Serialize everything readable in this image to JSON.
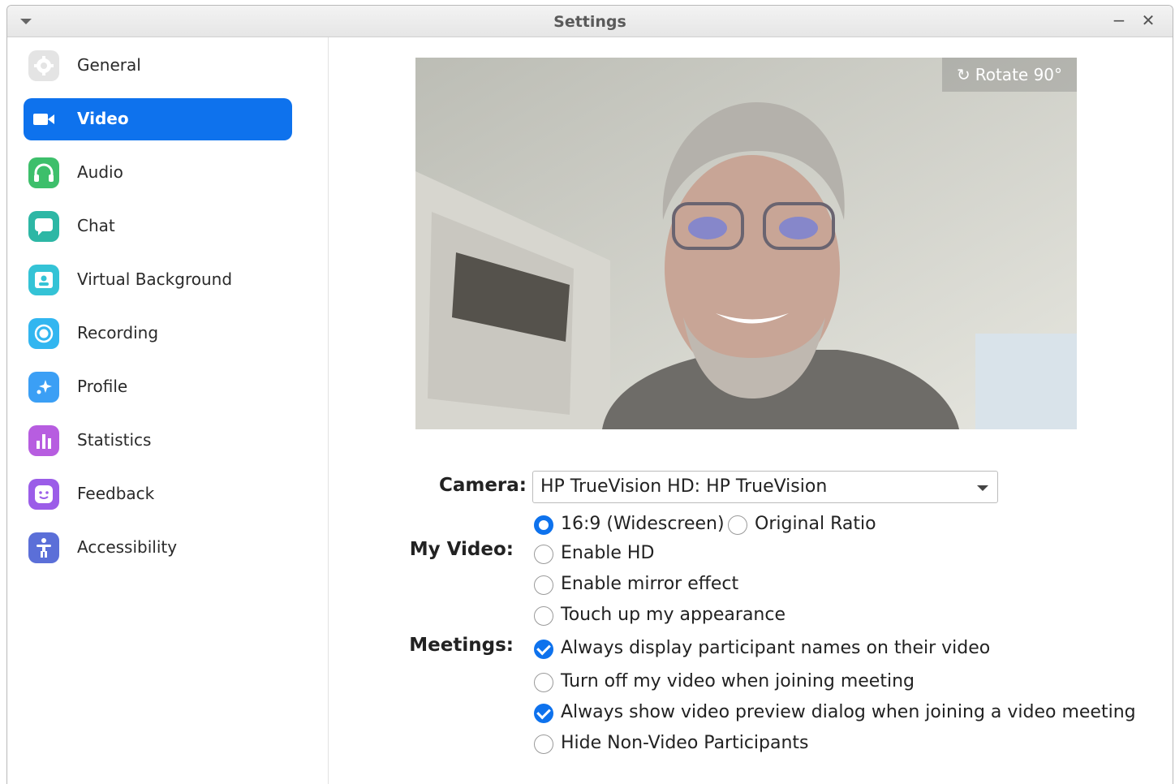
{
  "window": {
    "title": "Settings",
    "minimize_symbol": "−",
    "close_symbol": "✕"
  },
  "sidebar": {
    "items": [
      {
        "label": "General",
        "icon": "gear-icon",
        "color": "#e2e2e2",
        "active": false
      },
      {
        "label": "Video",
        "icon": "video-camera-icon",
        "color": "#0e72ed",
        "active": true
      },
      {
        "label": "Audio",
        "icon": "headphones-icon",
        "color": "#3dbf6b",
        "active": false
      },
      {
        "label": "Chat",
        "icon": "chat-bubble-icon",
        "color": "#2db7a5",
        "active": false
      },
      {
        "label": "Virtual Background",
        "icon": "person-card-icon",
        "color": "#34c3d6",
        "active": false
      },
      {
        "label": "Recording",
        "icon": "record-icon",
        "color": "#32b6f0",
        "active": false
      },
      {
        "label": "Profile",
        "icon": "profile-sparkle-icon",
        "color": "#3b9ff5",
        "active": false
      },
      {
        "label": "Statistics",
        "icon": "bar-chart-icon",
        "color": "#b75de0",
        "active": false
      },
      {
        "label": "Feedback",
        "icon": "smiley-icon",
        "color": "#9b5de8",
        "active": false
      },
      {
        "label": "Accessibility",
        "icon": "accessibility-person-icon",
        "color": "#5b6fd8",
        "active": false
      }
    ]
  },
  "preview": {
    "rotate_label": "Rotate 90°",
    "rotate_icon": "rotate-icon"
  },
  "camera": {
    "label": "Camera:",
    "selected": "HP TrueVision HD: HP TrueVision"
  },
  "my_video": {
    "label": "My Video:",
    "ratio_options": [
      {
        "label": "16:9 (Widescreen)",
        "selected": true
      },
      {
        "label": "Original Ratio",
        "selected": false
      }
    ],
    "options": [
      {
        "label": "Enable HD",
        "checked": false
      },
      {
        "label": "Enable mirror effect",
        "checked": false
      },
      {
        "label": "Touch up my appearance",
        "checked": false
      }
    ]
  },
  "meetings": {
    "label": "Meetings:",
    "options": [
      {
        "label": "Always display participant names on their video",
        "checked": true
      },
      {
        "label": "Turn off my video when joining meeting",
        "checked": false
      },
      {
        "label": "Always show video preview dialog when joining a video meeting",
        "checked": true
      },
      {
        "label": "Hide Non-Video Participants",
        "checked": false
      }
    ]
  },
  "colors": {
    "accent": "#0e72ed"
  }
}
